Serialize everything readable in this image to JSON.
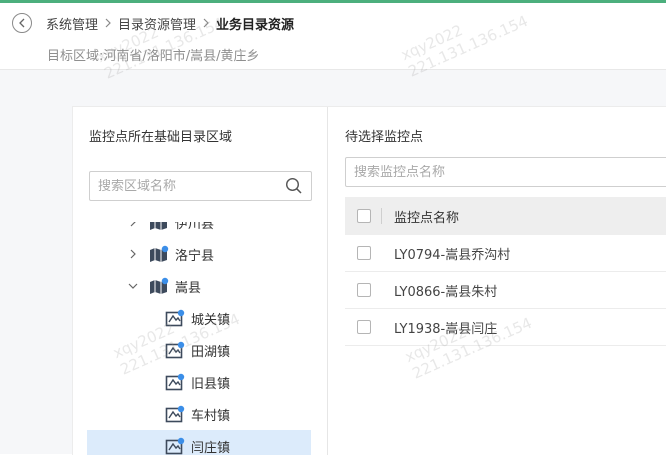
{
  "header": {
    "breadcrumb": [
      "系统管理",
      "目录资源管理",
      "业务目录资源"
    ],
    "region": "目标区域:河南省/洛阳市/嵩县/黄庄乡"
  },
  "left_panel": {
    "title": "监控点所在基础目录区域",
    "search_placeholder": "搜索区域名称",
    "tree": [
      {
        "label": "伊川县",
        "level": 1,
        "expand": "collapsed"
      },
      {
        "label": "洛宁县",
        "level": 1,
        "expand": "collapsed"
      },
      {
        "label": "嵩县",
        "level": 1,
        "expand": "expanded"
      },
      {
        "label": "城关镇",
        "level": 2
      },
      {
        "label": "田湖镇",
        "level": 2
      },
      {
        "label": "旧县镇",
        "level": 2
      },
      {
        "label": "车村镇",
        "level": 2
      },
      {
        "label": "闫庄镇",
        "level": 2,
        "selected": true
      }
    ]
  },
  "right_panel": {
    "title": "待选择监控点",
    "search_placeholder": "搜索监控点名称",
    "column_header": "监控点名称",
    "rows": [
      "LY0794-嵩县乔沟村",
      "LY0866-嵩县朱村",
      "LY1938-嵩县闫庄"
    ]
  },
  "watermark": {
    "user": "xqy2022",
    "ip": "221.131.136.154"
  },
  "colors": {
    "accent_bar": "#4caf7d",
    "selected_bg": "#dcebfb",
    "map_icon": "#3d4a5c",
    "map_icon_dot": "#3b8ee8"
  }
}
